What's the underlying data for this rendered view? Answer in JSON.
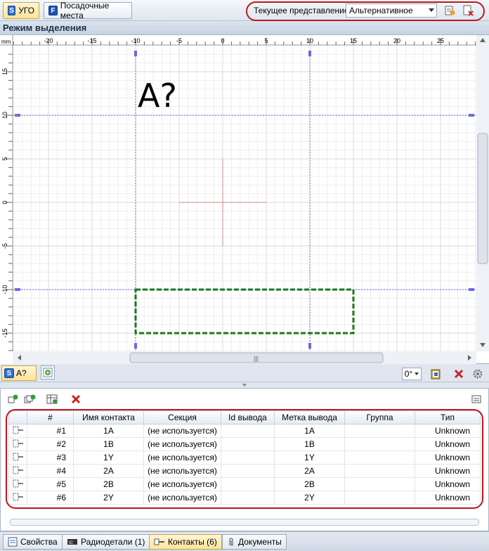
{
  "toolbar": {
    "tab_ugo": "УГО",
    "tab_footprints": "Посадочные места",
    "view_label": "Текущее представление",
    "view_value": "Альтернативное"
  },
  "mode_bar": {
    "title": "Режим выделения"
  },
  "canvas": {
    "unit": "mm",
    "ruler_x_labels": [
      "-20",
      "-15",
      "-10",
      "-5",
      "0",
      "5",
      "10",
      "15",
      "20",
      "25"
    ],
    "ruler_y_labels": [
      "15",
      "10",
      "5",
      "0",
      "-5",
      "-10",
      "-15"
    ],
    "refdes_text": "A?",
    "colors": {
      "grid": "#e6e6e6",
      "guide": "#6a6ae0",
      "outline": "#1a7a1a",
      "origin": "#c88a8a"
    }
  },
  "component_strip": {
    "tab_label": "A?",
    "rotation": "0°"
  },
  "pins_table": {
    "columns": [
      "",
      "#",
      "Имя контакта",
      "Секция",
      "Id вывода",
      "Метка вывода",
      "Группа",
      "Тип"
    ],
    "rows": [
      {
        "num": "#1",
        "name": "1A",
        "section": "(не используется)",
        "id": "",
        "label": "1A",
        "group": "",
        "type": "Unknown"
      },
      {
        "num": "#2",
        "name": "1B",
        "section": "(не используется)",
        "id": "",
        "label": "1B",
        "group": "",
        "type": "Unknown"
      },
      {
        "num": "#3",
        "name": "1Y",
        "section": "(не используется)",
        "id": "",
        "label": "1Y",
        "group": "",
        "type": "Unknown"
      },
      {
        "num": "#4",
        "name": "2A",
        "section": "(не используется)",
        "id": "",
        "label": "2A",
        "group": "",
        "type": "Unknown"
      },
      {
        "num": "#5",
        "name": "2B",
        "section": "(не используется)",
        "id": "",
        "label": "2B",
        "group": "",
        "type": "Unknown"
      },
      {
        "num": "#6",
        "name": "2Y",
        "section": "(не используется)",
        "id": "",
        "label": "2Y",
        "group": "",
        "type": "Unknown"
      }
    ]
  },
  "bottom_tabs": {
    "properties": "Свойства",
    "parts": "Радиодетали (1)",
    "contacts": "Контакты (6)",
    "documents": "Документы"
  }
}
